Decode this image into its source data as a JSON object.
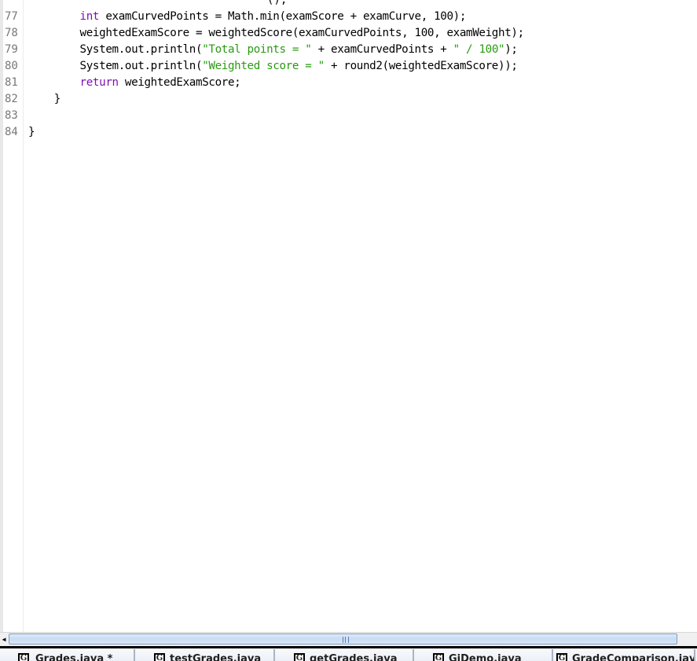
{
  "editor": {
    "partial_top_line": "();",
    "lines": [
      {
        "number": "77",
        "indent": "        ",
        "parts": [
          {
            "t": "int",
            "c": "kw"
          },
          {
            "t": " examCurvedPoints = Math.min(examScore + examCurve, 100);",
            "c": ""
          }
        ]
      },
      {
        "number": "78",
        "indent": "        ",
        "parts": [
          {
            "t": "weightedExamScore = weightedScore(examCurvedPoints, 100, examWeight);",
            "c": ""
          }
        ]
      },
      {
        "number": "79",
        "indent": "        ",
        "parts": [
          {
            "t": "System.out.println(",
            "c": ""
          },
          {
            "t": "\"Total points = \"",
            "c": "str"
          },
          {
            "t": " + examCurvedPoints + ",
            "c": ""
          },
          {
            "t": "\" / 100\"",
            "c": "str"
          },
          {
            "t": ");",
            "c": ""
          }
        ]
      },
      {
        "number": "80",
        "indent": "        ",
        "parts": [
          {
            "t": "System.out.println(",
            "c": ""
          },
          {
            "t": "\"Weighted score = \"",
            "c": "str"
          },
          {
            "t": " + round2(weightedExamScore));",
            "c": ""
          }
        ]
      },
      {
        "number": "81",
        "indent": "        ",
        "parts": [
          {
            "t": "return",
            "c": "kw"
          },
          {
            "t": " weightedExamScore;",
            "c": ""
          }
        ]
      },
      {
        "number": "82",
        "indent": "    ",
        "parts": [
          {
            "t": "}",
            "c": ""
          }
        ]
      },
      {
        "number": "83",
        "indent": "",
        "parts": []
      },
      {
        "number": "84",
        "indent": "",
        "parts": [
          {
            "t": "}",
            "c": ""
          }
        ]
      }
    ]
  },
  "scrollbar": {
    "left_arrow_icon": "◀"
  },
  "tabs": [
    {
      "icon": "G",
      "label": "Grades.java *"
    },
    {
      "icon": "G",
      "label": "testGrades.java"
    },
    {
      "icon": "G",
      "label": "getGrades.java"
    },
    {
      "icon": "G",
      "label": "GiDemo.java"
    },
    {
      "icon": "G",
      "label": "GradeComparison.java *"
    }
  ],
  "colors": {
    "keyword": "#7f0fb5",
    "string": "#2a9a12",
    "line_number": "#787878",
    "scroll_thumb_border": "#7f9dc8"
  }
}
